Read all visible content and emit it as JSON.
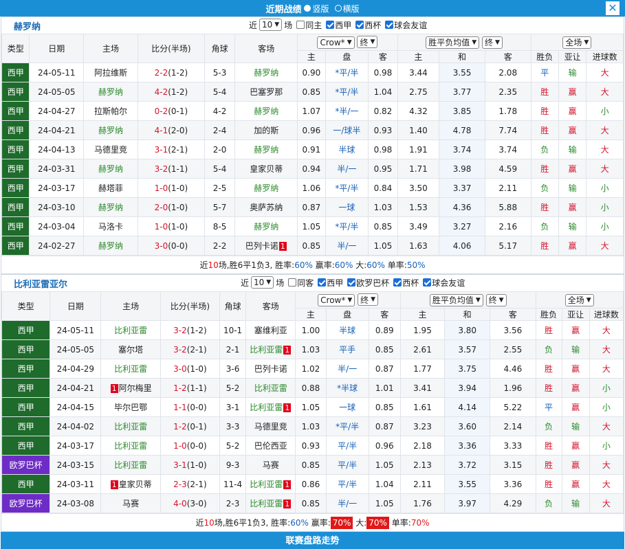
{
  "topbar": {
    "title": "近期战绩",
    "opt_vertical": "竖版",
    "opt_horizontal": "横版",
    "close": "✕"
  },
  "sections": [
    {
      "team": "赫罗纳",
      "ctrl": {
        "near": "近",
        "count": "10",
        "unit": "场",
        "same": "同主",
        "filters": [
          "西甲",
          "西杯",
          "球会友谊"
        ]
      },
      "cols": {
        "type": "类型",
        "date": "日期",
        "home": "主场",
        "score": "比分(半场)",
        "corner": "角球",
        "away": "客场",
        "company": "Crow*",
        "status1": "终",
        "avg": "胜平负均值",
        "status2": "终",
        "scope": "全场",
        "sub_home": "主",
        "sub_line": "盘",
        "sub_away": "客",
        "sub_h": "主",
        "sub_d": "和",
        "sub_a": "客",
        "wl": "胜负",
        "ah": "亚让",
        "ou": "进球数"
      },
      "rows": [
        {
          "type": "西甲",
          "date": "24-05-11",
          "home": "阿拉维斯",
          "home_c": "k",
          "score": "2-2",
          "half": "(1-2)",
          "corner": "5-3",
          "away": "赫罗纳",
          "away_c": "g",
          "oh": "0.90",
          "line": "*平/半",
          "oa": "0.98",
          "w": "3.44",
          "d": "3.55",
          "l": "2.08",
          "wl": "平",
          "wl_c": "b",
          "ah": "输",
          "ah_c": "g",
          "ou": "大",
          "ou_c": "r"
        },
        {
          "type": "西甲",
          "date": "24-05-05",
          "home": "赫罗纳",
          "home_c": "g",
          "score": "4-2",
          "half": "(1-2)",
          "corner": "5-4",
          "away": "巴塞罗那",
          "away_c": "k",
          "oh": "0.85",
          "line": "*平/半",
          "oa": "1.04",
          "w": "2.75",
          "d": "3.77",
          "l": "2.35",
          "wl": "胜",
          "wl_c": "r",
          "ah": "赢",
          "ah_c": "r",
          "ou": "大",
          "ou_c": "r"
        },
        {
          "type": "西甲",
          "date": "24-04-27",
          "home": "拉斯帕尔",
          "home_c": "k",
          "score": "0-2",
          "half": "(0-1)",
          "corner": "4-2",
          "away": "赫罗纳",
          "away_c": "g",
          "oh": "1.07",
          "line": "*半/一",
          "oa": "0.82",
          "w": "4.32",
          "d": "3.85",
          "l": "1.78",
          "wl": "胜",
          "wl_c": "r",
          "ah": "赢",
          "ah_c": "r",
          "ou": "小",
          "ou_c": "g"
        },
        {
          "type": "西甲",
          "date": "24-04-21",
          "home": "赫罗纳",
          "home_c": "g",
          "score": "4-1",
          "half": "(2-0)",
          "corner": "2-4",
          "away": "加的斯",
          "away_c": "k",
          "oh": "0.96",
          "line": "一/球半",
          "oa": "0.93",
          "w": "1.40",
          "d": "4.78",
          "l": "7.74",
          "wl": "胜",
          "wl_c": "r",
          "ah": "赢",
          "ah_c": "r",
          "ou": "大",
          "ou_c": "r"
        },
        {
          "type": "西甲",
          "date": "24-04-13",
          "home": "马德里竞",
          "home_c": "k",
          "score": "3-1",
          "half": "(2-1)",
          "corner": "2-0",
          "away": "赫罗纳",
          "away_c": "g",
          "oh": "0.91",
          "line": "半球",
          "oa": "0.98",
          "w": "1.91",
          "d": "3.74",
          "l": "3.74",
          "wl": "负",
          "wl_c": "g",
          "ah": "输",
          "ah_c": "g",
          "ou": "大",
          "ou_c": "r"
        },
        {
          "type": "西甲",
          "date": "24-03-31",
          "home": "赫罗纳",
          "home_c": "g",
          "score": "3-2",
          "half": "(1-1)",
          "corner": "5-4",
          "away": "皇家贝蒂",
          "away_c": "k",
          "oh": "0.94",
          "line": "半/一",
          "oa": "0.95",
          "w": "1.71",
          "d": "3.98",
          "l": "4.59",
          "wl": "胜",
          "wl_c": "r",
          "ah": "赢",
          "ah_c": "r",
          "ou": "大",
          "ou_c": "r"
        },
        {
          "type": "西甲",
          "date": "24-03-17",
          "home": "赫塔菲",
          "home_c": "k",
          "score": "1-0",
          "half": "(1-0)",
          "corner": "2-5",
          "away": "赫罗纳",
          "away_c": "g",
          "oh": "1.06",
          "line": "*平/半",
          "oa": "0.84",
          "w": "3.50",
          "d": "3.37",
          "l": "2.11",
          "wl": "负",
          "wl_c": "g",
          "ah": "输",
          "ah_c": "g",
          "ou": "小",
          "ou_c": "g"
        },
        {
          "type": "西甲",
          "date": "24-03-10",
          "home": "赫罗纳",
          "home_c": "g",
          "score": "2-0",
          "half": "(1-0)",
          "corner": "5-7",
          "away": "奥萨苏纳",
          "away_c": "k",
          "oh": "0.87",
          "line": "一球",
          "oa": "1.03",
          "w": "1.53",
          "d": "4.36",
          "l": "5.88",
          "wl": "胜",
          "wl_c": "r",
          "ah": "赢",
          "ah_c": "r",
          "ou": "小",
          "ou_c": "g"
        },
        {
          "type": "西甲",
          "date": "24-03-04",
          "home": "马洛卡",
          "home_c": "k",
          "score": "1-0",
          "half": "(1-0)",
          "corner": "8-5",
          "away": "赫罗纳",
          "away_c": "g",
          "oh": "1.05",
          "line": "*平/半",
          "oa": "0.85",
          "w": "3.49",
          "d": "3.27",
          "l": "2.16",
          "wl": "负",
          "wl_c": "g",
          "ah": "输",
          "ah_c": "g",
          "ou": "小",
          "ou_c": "g"
        },
        {
          "type": "西甲",
          "date": "24-02-27",
          "home": "赫罗纳",
          "home_c": "g",
          "score": "3-0",
          "half": "(0-0)",
          "corner": "2-2",
          "away": "巴列卡诺",
          "away_c": "k",
          "away_rc": "1",
          "oh": "0.85",
          "line": "半/一",
          "oa": "1.05",
          "w": "1.63",
          "d": "4.06",
          "l": "5.17",
          "wl": "胜",
          "wl_c": "r",
          "ah": "赢",
          "ah_c": "r",
          "ou": "大",
          "ou_c": "r"
        }
      ],
      "summary": {
        "p1": "近",
        "n": "10",
        "p2": "场,胜6平1负3, 胜率:",
        "win": "60%",
        "p3": " 赢率:",
        "ying": "60%",
        "p4": " 大:",
        "da": "60%",
        "p5": " 单率:",
        "dan": "50%"
      }
    },
    {
      "team": "比利亚雷亚尔",
      "ctrl": {
        "near": "近",
        "count": "10",
        "unit": "场",
        "same": "同客",
        "filters": [
          "西甲",
          "欧罗巴杯",
          "西杯",
          "球会友谊"
        ]
      },
      "cols": {
        "type": "类型",
        "date": "日期",
        "home": "主场",
        "score": "比分(半场)",
        "corner": "角球",
        "away": "客场",
        "company": "Crow*",
        "status1": "终",
        "avg": "胜平负均值",
        "status2": "终",
        "scope": "全场",
        "sub_home": "主",
        "sub_line": "盘",
        "sub_away": "客",
        "sub_h": "主",
        "sub_d": "和",
        "sub_a": "客",
        "wl": "胜负",
        "ah": "亚让",
        "ou": "进球数"
      },
      "rows": [
        {
          "type": "西甲",
          "date": "24-05-11",
          "home": "比利亚雷",
          "home_c": "g",
          "score": "3-2",
          "half": "(1-2)",
          "corner": "10-1",
          "away": "塞维利亚",
          "away_c": "k",
          "oh": "1.00",
          "line": "半球",
          "oa": "0.89",
          "w": "1.95",
          "d": "3.80",
          "l": "3.56",
          "wl": "胜",
          "wl_c": "r",
          "ah": "赢",
          "ah_c": "r",
          "ou": "大",
          "ou_c": "r"
        },
        {
          "type": "西甲",
          "date": "24-05-05",
          "home": "塞尔塔",
          "home_c": "k",
          "score": "3-2",
          "half": "(2-1)",
          "corner": "2-1",
          "away": "比利亚雷",
          "away_c": "g",
          "away_rc": "1",
          "oh": "1.03",
          "line": "平手",
          "oa": "0.85",
          "w": "2.61",
          "d": "3.57",
          "l": "2.55",
          "wl": "负",
          "wl_c": "g",
          "ah": "输",
          "ah_c": "g",
          "ou": "大",
          "ou_c": "r"
        },
        {
          "type": "西甲",
          "date": "24-04-29",
          "home": "比利亚雷",
          "home_c": "g",
          "score": "3-0",
          "half": "(1-0)",
          "corner": "3-6",
          "away": "巴列卡诺",
          "away_c": "k",
          "oh": "1.02",
          "line": "半/一",
          "oa": "0.87",
          "w": "1.77",
          "d": "3.75",
          "l": "4.46",
          "wl": "胜",
          "wl_c": "r",
          "ah": "赢",
          "ah_c": "r",
          "ou": "大",
          "ou_c": "r"
        },
        {
          "type": "西甲",
          "date": "24-04-21",
          "home": "阿尔梅里",
          "home_c": "k",
          "home_rc": "1",
          "score": "1-2",
          "half": "(1-1)",
          "corner": "5-2",
          "away": "比利亚雷",
          "away_c": "g",
          "oh": "0.88",
          "line": "*半球",
          "oa": "1.01",
          "w": "3.41",
          "d": "3.94",
          "l": "1.96",
          "wl": "胜",
          "wl_c": "r",
          "ah": "赢",
          "ah_c": "r",
          "ou": "小",
          "ou_c": "g"
        },
        {
          "type": "西甲",
          "date": "24-04-15",
          "home": "毕尔巴鄂",
          "home_c": "k",
          "score": "1-1",
          "half": "(0-0)",
          "corner": "3-1",
          "away": "比利亚雷",
          "away_c": "g",
          "away_rc": "1",
          "oh": "1.05",
          "line": "一球",
          "oa": "0.85",
          "w": "1.61",
          "d": "4.14",
          "l": "5.22",
          "wl": "平",
          "wl_c": "b",
          "ah": "赢",
          "ah_c": "r",
          "ou": "小",
          "ou_c": "g"
        },
        {
          "type": "西甲",
          "date": "24-04-02",
          "home": "比利亚雷",
          "home_c": "g",
          "score": "1-2",
          "half": "(0-1)",
          "corner": "3-3",
          "away": "马德里竞",
          "away_c": "k",
          "oh": "1.03",
          "line": "*平/半",
          "oa": "0.87",
          "w": "3.23",
          "d": "3.60",
          "l": "2.14",
          "wl": "负",
          "wl_c": "g",
          "ah": "输",
          "ah_c": "g",
          "ou": "大",
          "ou_c": "r"
        },
        {
          "type": "西甲",
          "date": "24-03-17",
          "home": "比利亚雷",
          "home_c": "g",
          "score": "1-0",
          "half": "(0-0)",
          "corner": "5-2",
          "away": "巴伦西亚",
          "away_c": "k",
          "oh": "0.93",
          "line": "平/半",
          "oa": "0.96",
          "w": "2.18",
          "d": "3.36",
          "l": "3.33",
          "wl": "胜",
          "wl_c": "r",
          "ah": "赢",
          "ah_c": "r",
          "ou": "小",
          "ou_c": "g"
        },
        {
          "type": "欧罗巴杯",
          "euro": true,
          "date": "24-03-15",
          "home": "比利亚雷",
          "home_c": "g",
          "score": "3-1",
          "half": "(1-0)",
          "corner": "9-3",
          "away": "马赛",
          "away_c": "k",
          "oh": "0.85",
          "line": "平/半",
          "oa": "1.05",
          "w": "2.13",
          "d": "3.72",
          "l": "3.15",
          "wl": "胜",
          "wl_c": "r",
          "ah": "赢",
          "ah_c": "r",
          "ou": "大",
          "ou_c": "r"
        },
        {
          "type": "西甲",
          "date": "24-03-11",
          "home": "皇家贝蒂",
          "home_c": "k",
          "home_rc": "1",
          "score": "2-3",
          "half": "(2-1)",
          "corner": "11-4",
          "away": "比利亚雷",
          "away_c": "g",
          "away_rc": "1",
          "oh": "0.86",
          "line": "平/半",
          "oa": "1.04",
          "w": "2.11",
          "d": "3.55",
          "l": "3.36",
          "wl": "胜",
          "wl_c": "r",
          "ah": "赢",
          "ah_c": "r",
          "ou": "大",
          "ou_c": "r"
        },
        {
          "type": "欧罗巴杯",
          "euro": true,
          "date": "24-03-08",
          "home": "马赛",
          "home_c": "k",
          "score": "4-0",
          "half": "(3-0)",
          "corner": "2-3",
          "away": "比利亚雷",
          "away_c": "g",
          "away_rc": "1",
          "oh": "0.85",
          "line": "半/一",
          "oa": "1.05",
          "w": "1.76",
          "d": "3.97",
          "l": "4.29",
          "wl": "负",
          "wl_c": "g",
          "ah": "输",
          "ah_c": "g",
          "ou": "大",
          "ou_c": "r"
        }
      ],
      "summary": {
        "p1": "近",
        "n": "10",
        "p2": "场,胜6平1负3, 胜率:",
        "win": "60%",
        "p3": " 赢率:",
        "ying": "70%",
        "p4": " 大:",
        "da": "70%",
        "p5": " 单率:",
        "dan": "70%"
      }
    }
  ],
  "bottombar": {
    "title": "联赛盘路走势"
  }
}
